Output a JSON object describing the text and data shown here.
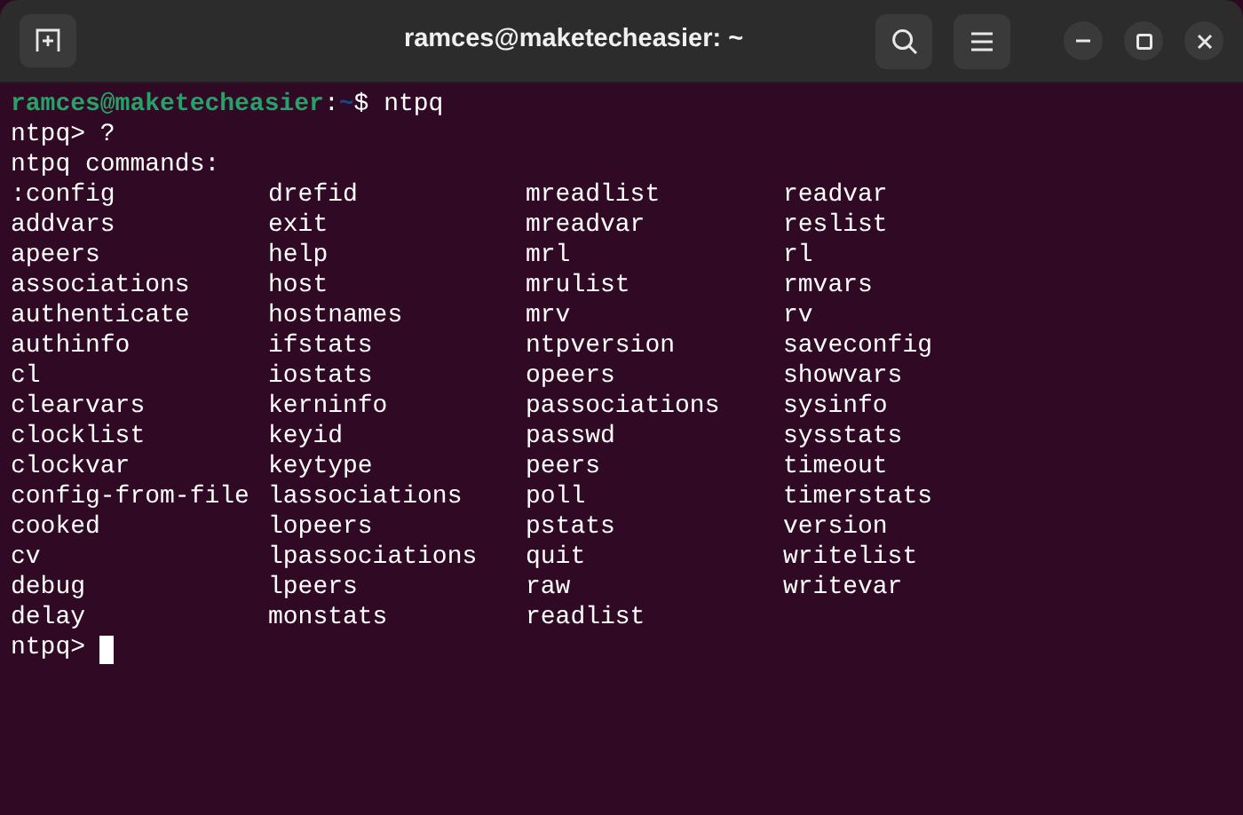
{
  "window": {
    "title": "ramces@maketecheasier: ~"
  },
  "terminal": {
    "prompt": {
      "user_host": "ramces@maketecheasier",
      "separator": ":",
      "path": "~",
      "symbol": "$",
      "command": "ntpq"
    },
    "lines": [
      "ntpq> ?",
      "ntpq commands:"
    ],
    "command_rows": [
      [
        ":config",
        "drefid",
        "mreadlist",
        "readvar"
      ],
      [
        "addvars",
        "exit",
        "mreadvar",
        "reslist"
      ],
      [
        "apeers",
        "help",
        "mrl",
        "rl"
      ],
      [
        "associations",
        "host",
        "mrulist",
        "rmvars"
      ],
      [
        "authenticate",
        "hostnames",
        "mrv",
        "rv"
      ],
      [
        "authinfo",
        "ifstats",
        "ntpversion",
        "saveconfig"
      ],
      [
        "cl",
        "iostats",
        "opeers",
        "showvars"
      ],
      [
        "clearvars",
        "kerninfo",
        "passociations",
        "sysinfo"
      ],
      [
        "clocklist",
        "keyid",
        "passwd",
        "sysstats"
      ],
      [
        "clockvar",
        "keytype",
        "peers",
        "timeout"
      ],
      [
        "config-from-file",
        "lassociations",
        "poll",
        "timerstats"
      ],
      [
        "cooked",
        "lopeers",
        "pstats",
        "version"
      ],
      [
        "cv",
        "lpassociations",
        "quit",
        "writelist"
      ],
      [
        "debug",
        "lpeers",
        "raw",
        "writevar"
      ],
      [
        "delay",
        "monstats",
        "readlist"
      ]
    ],
    "final_prompt": "ntpq>"
  }
}
